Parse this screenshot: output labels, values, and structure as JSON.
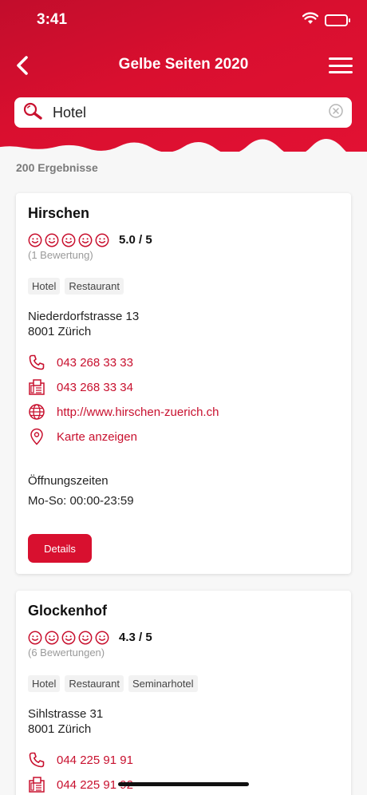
{
  "status_bar": {
    "time": "3:41"
  },
  "nav": {
    "title": "Gelbe Seiten 2020"
  },
  "search": {
    "query": "Hotel"
  },
  "results": {
    "count_label": "200 Ergebnisse"
  },
  "listings": [
    {
      "name": "Hirschen",
      "rating": "5.0 / 5",
      "reviews": "(1 Bewertung)",
      "tags": [
        "Hotel",
        "Restaurant"
      ],
      "street": "Niederdorfstrasse 13",
      "city": "8001 Zürich",
      "phone": "043 268 33 33",
      "fax": "043 268 33 34",
      "website": "http://www.hirschen-zuerich.ch",
      "map_label": "Karte anzeigen",
      "hours_label": "Öffnungszeiten",
      "hours": "Mo-So: 00:00-23:59",
      "details_label": "Details"
    },
    {
      "name": "Glockenhof",
      "rating": "4.3 / 5",
      "reviews": "(6 Bewertungen)",
      "tags": [
        "Hotel",
        "Restaurant",
        "Seminarhotel"
      ],
      "street": "Sihlstrasse 31",
      "city": "8001 Zürich",
      "phone": "044 225 91 91",
      "fax": "044 225 91 92"
    }
  ],
  "colors": {
    "brand": "#d8102f",
    "link": "#c8102e"
  }
}
